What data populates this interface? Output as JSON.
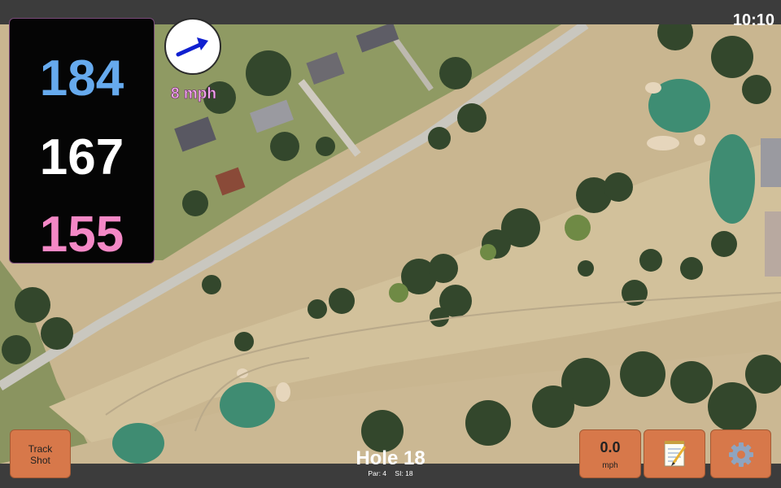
{
  "status_bar": {
    "time": "10:10"
  },
  "distances": {
    "back": "184",
    "middle": "167",
    "front": "155"
  },
  "wind": {
    "speed_text": "8 mph",
    "icon": "wind-direction-arrow-icon"
  },
  "track_shot": {
    "label_line1": "Track",
    "label_line2": "Shot"
  },
  "wind_button": {
    "value": "0.0",
    "unit": "mph"
  },
  "notes_button": {
    "icon": "notepad-icon"
  },
  "settings_button": {
    "icon": "gear-icon"
  },
  "hole": {
    "title": "Hole 18",
    "par": "Par: 4",
    "si": "SI: 18"
  },
  "colors": {
    "back": "#66aaee",
    "middle": "#ffffff",
    "front": "#f488c6",
    "button": "#d7784a"
  }
}
